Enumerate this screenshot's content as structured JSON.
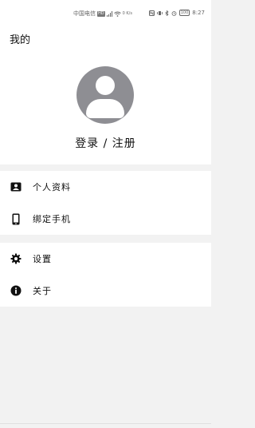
{
  "status_bar": {
    "carrier": "中国电信",
    "network_badge": "HD",
    "network_speed": "0 K/s",
    "battery": "100",
    "time": "8:27",
    "icons": [
      "signal-icon",
      "wifi-icon",
      "nfc-icon",
      "vibrate-icon",
      "bluetooth-icon",
      "alarm-icon",
      "battery-icon"
    ]
  },
  "header": {
    "title": "我的",
    "avatar_icon": "user-avatar-icon",
    "login_label": "登录 / 注册"
  },
  "menu": {
    "group1": [
      {
        "label": "个人资料",
        "icon": "profile-card-icon"
      },
      {
        "label": "绑定手机",
        "icon": "phone-icon"
      }
    ],
    "group2": [
      {
        "label": "设置",
        "icon": "gear-icon"
      },
      {
        "label": "关于",
        "icon": "info-icon"
      }
    ]
  },
  "colors": {
    "background": "#f2f2f2",
    "surface": "#ffffff",
    "avatar": "#8e8e93",
    "text": "#111111"
  }
}
